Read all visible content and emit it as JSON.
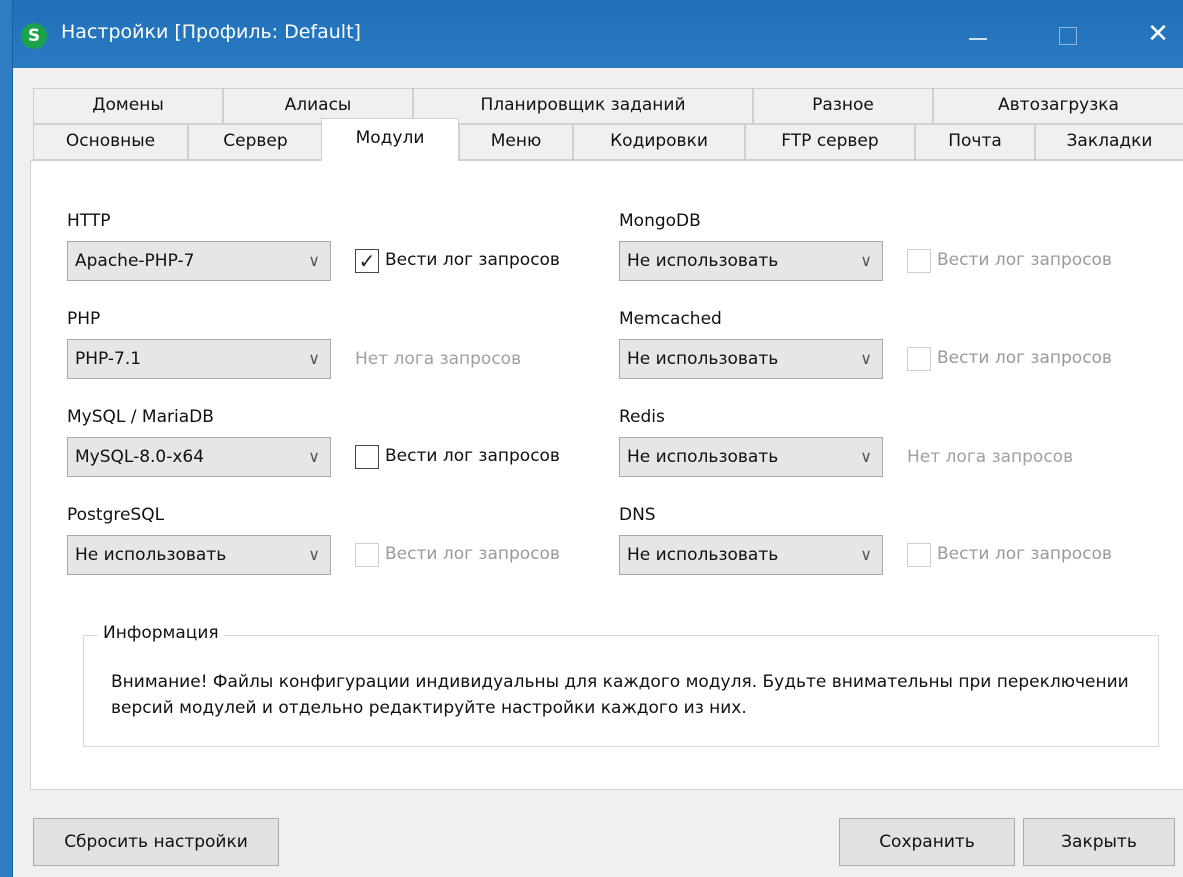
{
  "window": {
    "app_icon_letter": "S",
    "title": "Настройки [Профиль: Default]",
    "minimize_glyph": "—",
    "close_glyph": "✕"
  },
  "tabs_row1": [
    {
      "label": "Домены"
    },
    {
      "label": "Алиасы"
    },
    {
      "label": "Планировщик заданий"
    },
    {
      "label": "Разное"
    },
    {
      "label": "Автозагрузка"
    }
  ],
  "tabs_row2": [
    {
      "label": "Основные"
    },
    {
      "label": "Сервер"
    },
    {
      "label": "Модули",
      "active": true
    },
    {
      "label": "Меню"
    },
    {
      "label": "Кодировки"
    },
    {
      "label": "FTP сервер"
    },
    {
      "label": "Почта"
    },
    {
      "label": "Закладки"
    }
  ],
  "modules": {
    "http": {
      "label": "HTTP",
      "value": "Apache-PHP-7",
      "log_label": "Вести лог запросов",
      "log_checked": true
    },
    "php": {
      "label": "PHP",
      "value": "PHP-7.1",
      "no_log": "Нет лога запросов"
    },
    "mysql": {
      "label": "MySQL / MariaDB",
      "value": "MySQL-8.0-x64",
      "log_label": "Вести лог запросов",
      "log_checked": false
    },
    "postgresql": {
      "label": "PostgreSQL",
      "value": "Не использовать",
      "log_label": "Вести лог запросов",
      "log_disabled": true
    },
    "mongodb": {
      "label": "MongoDB",
      "value": "Не использовать",
      "log_label": "Вести лог запросов",
      "log_disabled": true
    },
    "memcached": {
      "label": "Memcached",
      "value": "Не использовать",
      "log_label": "Вести лог запросов",
      "log_disabled": true
    },
    "redis": {
      "label": "Redis",
      "value": "Не использовать",
      "no_log": "Нет лога запросов"
    },
    "dns": {
      "label": "DNS",
      "value": "Не использовать",
      "log_label": "Вести лог запросов",
      "log_disabled": true
    }
  },
  "info": {
    "legend": "Информация",
    "text": "Внимание! Файлы конфигурации индивидуальны для каждого модуля. Будьте внимательны при переключении версий модулей и отдельно редактируйте настройки каждого из них."
  },
  "buttons": {
    "reset": "Сбросить настройки",
    "save": "Сохранить",
    "close": "Закрыть"
  },
  "checkmark_glyph": "✓",
  "chevron_glyph": "∨",
  "colors": {
    "titlebar": "#2a7bc3",
    "app_icon": "#1aa34a",
    "disabled_text": "#9a9a9a"
  }
}
